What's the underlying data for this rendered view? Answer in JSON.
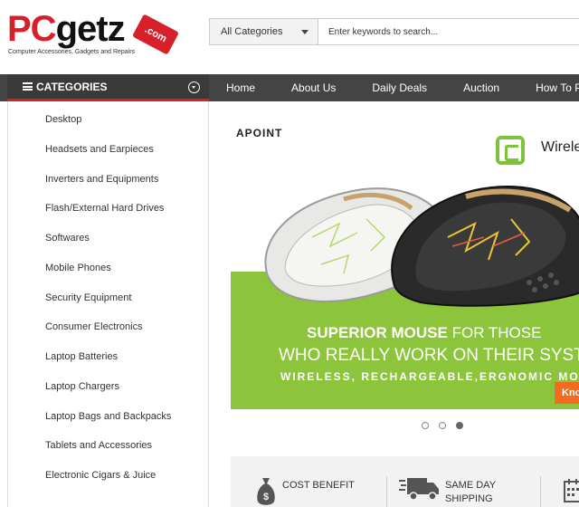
{
  "brand": {
    "logo_pc": "PC",
    "logo_getz": "getz",
    "logo_tag": ".com",
    "tagline": "Computer Accessories, Gadgets and Repairs",
    "accent": "#d8202a"
  },
  "search": {
    "category_value": "All Categories",
    "placeholder": "Enter keywords to search..."
  },
  "categories_header": {
    "label": "CATEGORIES",
    "icon": "list-icon"
  },
  "nav": {
    "items": [
      "Home",
      "About Us",
      "Daily Deals",
      "Auction",
      "How To Pay"
    ]
  },
  "sidebar": {
    "items": [
      "Desktop",
      "Headsets and Earpieces",
      "Inverters and Equipments",
      "Flash/External Hard Drives",
      "Softwares",
      "Mobile Phones",
      "Security Equipment",
      "Consumer Electronics",
      "Laptop Batteries",
      "Laptop Chargers",
      "Laptop Bags and Backpacks",
      "Tablets and Accessories",
      "Electronic Cigars & Juice"
    ]
  },
  "banner": {
    "brand": "APOINT",
    "wireless_text": "Wireless",
    "slogan_bold": "SUPERIOR MOUSE",
    "slogan_rest": " FOR THOSE",
    "slogan_line2": "WHO REALLY WORK ON THEIR SYSTEMS",
    "slogan_line3": "WIRELESS, RECHARGEABLE,ERGNOMIC MOUSE",
    "cta": "Know",
    "green": "#8cc43c",
    "cta_color": "#f26b21"
  },
  "carousel": {
    "slide_count": 3,
    "active_index": 2
  },
  "features": {
    "items": [
      {
        "label_line1": "COST BENEFIT",
        "label_line2": "",
        "icon": "money-bag-icon"
      },
      {
        "label_line1": "SAME DAY",
        "label_line2": "SHIPPING",
        "icon": "delivery-truck-icon"
      },
      {
        "label_line1": "",
        "label_line2": "",
        "icon": "calendar-icon"
      }
    ]
  }
}
